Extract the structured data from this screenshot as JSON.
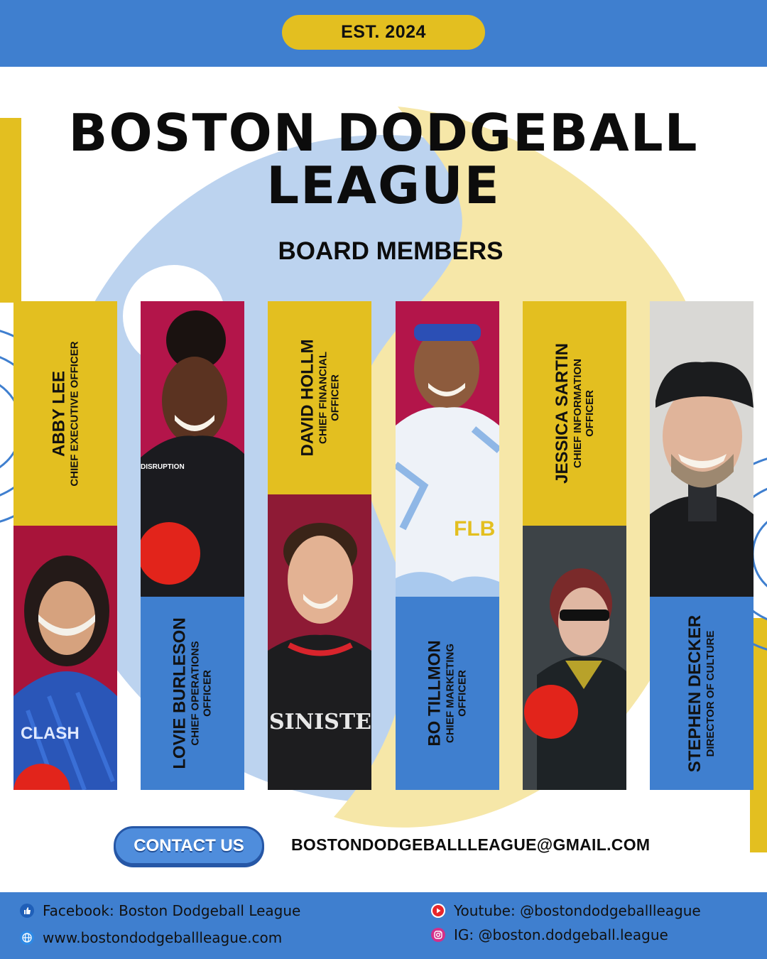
{
  "header": {
    "established": "EST. 2024"
  },
  "title": {
    "line1": "BOSTON DODGEBALL",
    "line2": "LEAGUE"
  },
  "subtitle": "BOARD MEMBERS",
  "members": [
    {
      "name": "ABBY LEE",
      "role": [
        "CHIEF EXECUTIVE OFFICER"
      ]
    },
    {
      "name": "LOVIE BURLESON",
      "role": [
        "CHIEF OPERATIONS",
        "OFFICER"
      ]
    },
    {
      "name": "DAVID HOLLM",
      "role": [
        "CHIEF FINANCIAL",
        "OFFICER"
      ]
    },
    {
      "name": "BO TILLMON",
      "role": [
        "CHIEF MARKETING",
        "OFFICER"
      ]
    },
    {
      "name": "JESSICA SARTIN",
      "role": [
        "CHIEF INFORMATION",
        "OFFICER"
      ]
    },
    {
      "name": "STEPHEN DECKER",
      "role": [
        "DIRECTOR OF CULTURE"
      ]
    }
  ],
  "contact": {
    "button_label": "CONTACT US",
    "email": "BOSTONDODGEBALLLEAGUE@GMAIL.COM"
  },
  "footer": {
    "facebook": "Facebook: Boston Dodgeball League",
    "website": "www.bostondodgeballleague.com",
    "youtube": "Youtube: @bostondodgeballleague",
    "instagram": "IG: @boston.dodgeball.league"
  },
  "colors": {
    "blue": "#3f7fcf",
    "yellow": "#e3bf20",
    "crimson": "#a8143a",
    "dark": "#0c0c0c"
  },
  "icons": [
    "facebook-icon",
    "globe-icon",
    "youtube-icon",
    "instagram-icon"
  ]
}
